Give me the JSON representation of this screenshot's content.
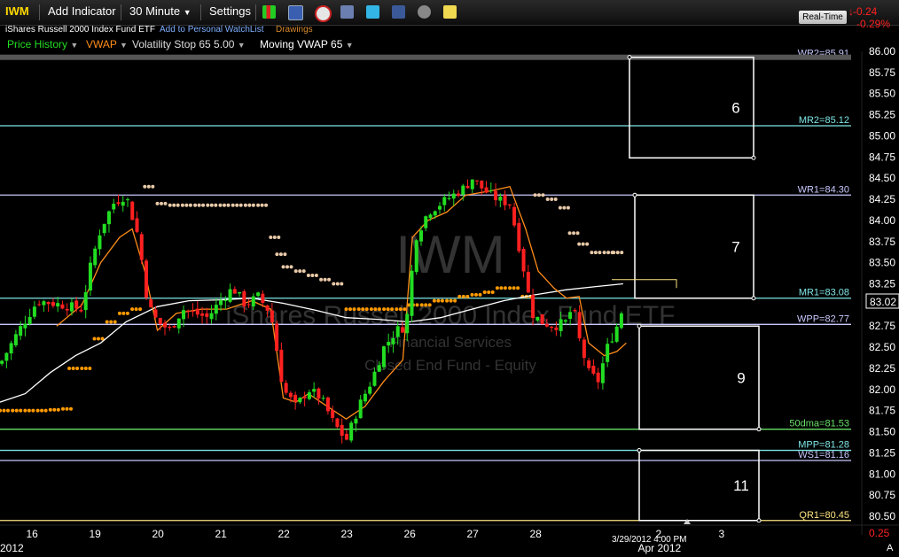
{
  "toolbar": {
    "symbol": "IWM",
    "add_indicator": "Add Indicator",
    "interval": "30 Minute",
    "settings": "Settings",
    "realtime": "Real-Time",
    "change": "-0.24",
    "change_pct": "-0.29%"
  },
  "subheader": {
    "security_name": "iShares Russell 2000 Index Fund ETF",
    "add_watchlist": "Add to Personal WatchList",
    "drawings": "Drawings"
  },
  "indicators": [
    {
      "label": "Price History",
      "color": "#22dd22"
    },
    {
      "label": "VWAP",
      "color": "#ff8c1a"
    },
    {
      "label": "Volatility Stop 65 5.00",
      "color": "#dddddd"
    },
    {
      "label": "Moving VWAP 65",
      "color": "#ffffff"
    }
  ],
  "watermark": {
    "symbol": "IWM",
    "name": "iShares Russell 2000 Index Fund ETF",
    "sector": "Financial Services",
    "industry": "Closed End Fund - Equity"
  },
  "chart_data": {
    "type": "candlestick",
    "y_range": [
      80.35,
      86.05
    ],
    "y_ticks": [
      "86.00",
      "85.75",
      "85.50",
      "85.25",
      "85.00",
      "84.75",
      "84.50",
      "84.25",
      "84.00",
      "83.75",
      "83.50",
      "83.25",
      "83.00",
      "82.75",
      "82.50",
      "82.25",
      "82.00",
      "81.75",
      "81.50",
      "81.25",
      "81.00",
      "80.75",
      "80.50",
      "0.25"
    ],
    "last_price": "83.02",
    "x_labels": [
      {
        "label": "2012",
        "pos": 0.0
      },
      {
        "label": "16",
        "pos": 0.5
      },
      {
        "label": "19",
        "pos": 1.5
      },
      {
        "label": "20",
        "pos": 2.5
      },
      {
        "label": "21",
        "pos": 3.5
      },
      {
        "label": "22",
        "pos": 4.5
      },
      {
        "label": "23",
        "pos": 5.5
      },
      {
        "label": "26",
        "pos": 6.5
      },
      {
        "label": "27",
        "pos": 7.5
      },
      {
        "label": "28",
        "pos": 8.5
      },
      {
        "label": "2",
        "pos": 10.5
      },
      {
        "label": "3",
        "pos": 11.5
      },
      {
        "label": "Apr 2012",
        "pos": 10.5
      }
    ],
    "crosshair_date": "3/29/2012 4:00 PM",
    "corner_label": "A",
    "levels": [
      {
        "label": "WR2=85.91",
        "value": 85.91,
        "color": "#c8c8ff"
      },
      {
        "label": "MR2=85.12",
        "value": 85.12,
        "color": "#7fe6e6"
      },
      {
        "label": "WR1=84.30",
        "value": 84.3,
        "color": "#c8c8ff"
      },
      {
        "label": "MR1=83.08",
        "value": 83.08,
        "color": "#7fe6e6"
      },
      {
        "label": "WPP=82.77",
        "value": 82.77,
        "color": "#c8c8ff"
      },
      {
        "label": "50dma=81.53",
        "value": 81.53,
        "color": "#66e066"
      },
      {
        "label": "MPP=81.28",
        "value": 81.28,
        "color": "#7fe6e6"
      },
      {
        "label": "WS1=81.16",
        "value": 81.16,
        "color": "#c8c8ff"
      },
      {
        "label": "QR1=80.45",
        "value": 80.45,
        "color": "#ffe680"
      }
    ],
    "boxes": [
      {
        "label": "6",
        "top": 85.93,
        "bottom": 84.74
      },
      {
        "label": "7",
        "top": 84.3,
        "bottom": 83.08
      },
      {
        "label": "9",
        "top": 82.75,
        "bottom": 81.53
      },
      {
        "label": "11",
        "top": 81.28,
        "bottom": 80.45
      }
    ],
    "price_path": [
      [
        0,
        82.3
      ],
      [
        0.3,
        82.7
      ],
      [
        0.6,
        83.05
      ],
      [
        1.0,
        83.0
      ],
      [
        1.3,
        82.95
      ],
      [
        1.45,
        83.5
      ],
      [
        1.6,
        83.9
      ],
      [
        1.8,
        84.2
      ],
      [
        2.0,
        84.3
      ],
      [
        2.2,
        83.8
      ],
      [
        2.35,
        83.0
      ],
      [
        2.5,
        82.8
      ],
      [
        2.7,
        82.7
      ],
      [
        2.9,
        82.95
      ],
      [
        3.1,
        82.9
      ],
      [
        3.3,
        82.85
      ],
      [
        3.5,
        83.05
      ],
      [
        3.7,
        83.2
      ],
      [
        3.9,
        83.0
      ],
      [
        4.1,
        83.1
      ],
      [
        4.3,
        82.9
      ],
      [
        4.5,
        82.0
      ],
      [
        4.7,
        81.8
      ],
      [
        4.9,
        82.0
      ],
      [
        5.1,
        81.9
      ],
      [
        5.3,
        81.6
      ],
      [
        5.5,
        81.4
      ],
      [
        5.7,
        81.8
      ],
      [
        5.9,
        82.1
      ],
      [
        6.1,
        82.5
      ],
      [
        6.3,
        82.7
      ],
      [
        6.45,
        82.75
      ],
      [
        6.6,
        83.8
      ],
      [
        6.8,
        84.1
      ],
      [
        7.0,
        84.2
      ],
      [
        7.2,
        84.3
      ],
      [
        7.4,
        84.4
      ],
      [
        7.5,
        84.5
      ],
      [
        7.7,
        84.35
      ],
      [
        7.9,
        84.25
      ],
      [
        8.1,
        84.2
      ],
      [
        8.3,
        83.5
      ],
      [
        8.45,
        82.9
      ],
      [
        8.6,
        82.8
      ],
      [
        8.8,
        82.75
      ],
      [
        9.0,
        82.8
      ],
      [
        9.1,
        83.0
      ],
      [
        9.2,
        82.6
      ],
      [
        9.35,
        82.2
      ],
      [
        9.5,
        82.1
      ],
      [
        9.65,
        82.5
      ],
      [
        9.8,
        82.75
      ],
      [
        9.93,
        83.05
      ]
    ],
    "vwap_path": [
      [
        0.9,
        82.75
      ],
      [
        1.3,
        83.0
      ],
      [
        1.6,
        83.5
      ],
      [
        1.9,
        83.8
      ],
      [
        2.1,
        83.9
      ],
      [
        2.3,
        83.4
      ],
      [
        2.5,
        82.7
      ],
      [
        2.8,
        82.9
      ],
      [
        3.2,
        82.95
      ],
      [
        3.6,
        82.95
      ],
      [
        4.0,
        83.05
      ],
      [
        4.3,
        82.95
      ],
      [
        4.5,
        81.9
      ],
      [
        4.7,
        81.85
      ],
      [
        4.9,
        81.95
      ],
      [
        5.2,
        81.8
      ],
      [
        5.5,
        81.65
      ],
      [
        5.8,
        81.8
      ],
      [
        6.1,
        82.1
      ],
      [
        6.4,
        82.35
      ],
      [
        6.55,
        83.8
      ],
      [
        6.8,
        84.0
      ],
      [
        7.1,
        84.1
      ],
      [
        7.4,
        84.3
      ],
      [
        7.8,
        84.35
      ],
      [
        8.1,
        84.4
      ],
      [
        8.35,
        83.9
      ],
      [
        8.55,
        83.4
      ],
      [
        8.8,
        83.2
      ],
      [
        9.0,
        83.08
      ],
      [
        9.2,
        83.1
      ],
      [
        9.35,
        82.55
      ],
      [
        9.6,
        82.4
      ],
      [
        9.8,
        82.45
      ],
      [
        9.95,
        82.55
      ]
    ],
    "mvwap_path": [
      [
        0,
        81.85
      ],
      [
        0.4,
        81.95
      ],
      [
        0.8,
        82.2
      ],
      [
        1.2,
        82.4
      ],
      [
        1.6,
        82.55
      ],
      [
        2.0,
        82.8
      ],
      [
        2.5,
        82.98
      ],
      [
        3.0,
        83.05
      ],
      [
        3.5,
        83.06
      ],
      [
        4.0,
        83.08
      ],
      [
        4.5,
        83.02
      ],
      [
        5.0,
        82.94
      ],
      [
        5.5,
        82.85
      ],
      [
        6.0,
        82.83
      ],
      [
        6.5,
        82.8
      ],
      [
        7.0,
        82.85
      ],
      [
        7.5,
        82.95
      ],
      [
        8.0,
        83.05
      ],
      [
        8.5,
        83.12
      ],
      [
        9.0,
        83.18
      ],
      [
        9.5,
        83.22
      ],
      [
        9.9,
        83.25
      ]
    ],
    "vstop_dots": [
      [
        0,
        81.75
      ],
      [
        0.2,
        81.75
      ],
      [
        0.4,
        81.75
      ],
      [
        0.6,
        81.75
      ],
      [
        0.8,
        81.76
      ],
      [
        1.0,
        81.77
      ],
      [
        1.1,
        82.25
      ],
      [
        1.3,
        82.25
      ],
      [
        1.5,
        82.6
      ],
      [
        1.7,
        82.8
      ],
      [
        1.9,
        82.9
      ],
      [
        2.1,
        82.95
      ],
      [
        2.3,
        84.4
      ],
      [
        2.5,
        84.2
      ],
      [
        2.7,
        84.18
      ],
      [
        2.9,
        84.18
      ],
      [
        3.1,
        84.18
      ],
      [
        3.3,
        84.18
      ],
      [
        3.5,
        84.18
      ],
      [
        3.7,
        84.18
      ],
      [
        3.9,
        84.18
      ],
      [
        4.1,
        84.18
      ],
      [
        4.3,
        83.8
      ],
      [
        4.4,
        83.6
      ],
      [
        4.5,
        83.45
      ],
      [
        4.7,
        83.4
      ],
      [
        4.9,
        83.35
      ],
      [
        5.1,
        83.3
      ],
      [
        5.3,
        83.25
      ],
      [
        5.5,
        82.95
      ],
      [
        5.7,
        82.95
      ],
      [
        5.9,
        82.95
      ],
      [
        6.1,
        82.95
      ],
      [
        6.3,
        82.95
      ],
      [
        6.5,
        83.0
      ],
      [
        6.7,
        83.0
      ],
      [
        6.9,
        83.05
      ],
      [
        7.1,
        83.05
      ],
      [
        7.3,
        83.1
      ],
      [
        7.5,
        83.12
      ],
      [
        7.7,
        83.15
      ],
      [
        7.9,
        83.2
      ],
      [
        8.1,
        83.2
      ],
      [
        8.3,
        83.1
      ],
      [
        8.5,
        84.3
      ],
      [
        8.7,
        84.25
      ],
      [
        8.9,
        84.15
      ],
      [
        9.05,
        83.85
      ],
      [
        9.2,
        83.72
      ],
      [
        9.4,
        83.62
      ],
      [
        9.6,
        83.62
      ],
      [
        9.75,
        83.62
      ]
    ]
  }
}
